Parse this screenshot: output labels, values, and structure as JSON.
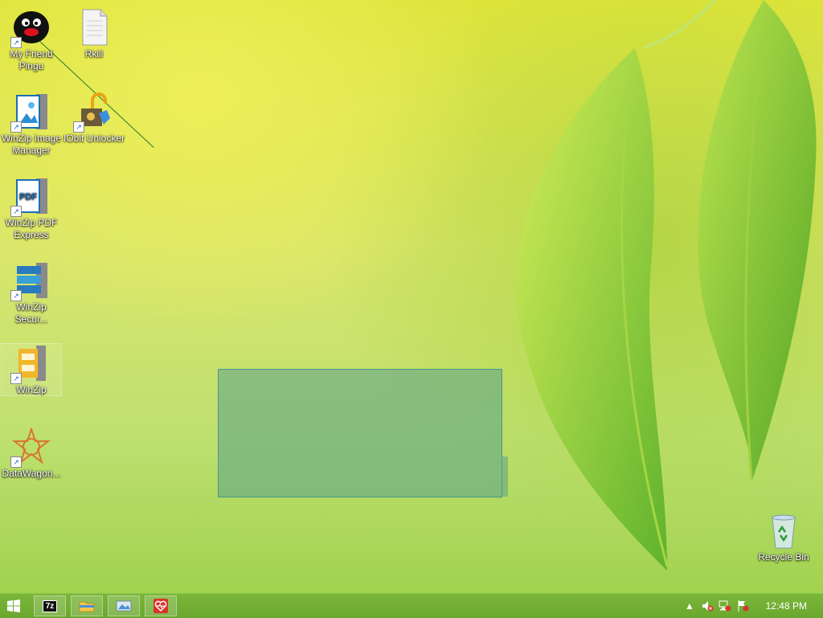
{
  "desktop": {
    "icons": [
      {
        "label": "My Friend Pingu",
        "icon": "pingu-icon"
      },
      {
        "label": "Rkill",
        "icon": "document-icon"
      },
      {
        "label": "WinZip Image Manager",
        "icon": "winzip-image-manager-icon"
      },
      {
        "label": "IObit Unlocker",
        "icon": "iobit-unlocker-icon"
      },
      {
        "label": "WinZip PDF Express",
        "icon": "winzip-pdf-icon"
      },
      {
        "label": "WinZip Secur...",
        "icon": "winzip-secure-icon"
      },
      {
        "label": "WinZip",
        "icon": "winzip-icon"
      },
      {
        "label": "DataWagon...",
        "icon": "datawagon-icon"
      },
      {
        "label": "Recycle Bin",
        "icon": "recycle-bin-icon"
      }
    ],
    "pdf_badge": "PDF"
  },
  "taskbar": {
    "pinned": [
      {
        "name": "7zip",
        "label": "7z"
      },
      {
        "name": "file-explorer"
      },
      {
        "name": "photo-viewer"
      },
      {
        "name": "health-app"
      }
    ],
    "clock": "12:48 PM"
  }
}
